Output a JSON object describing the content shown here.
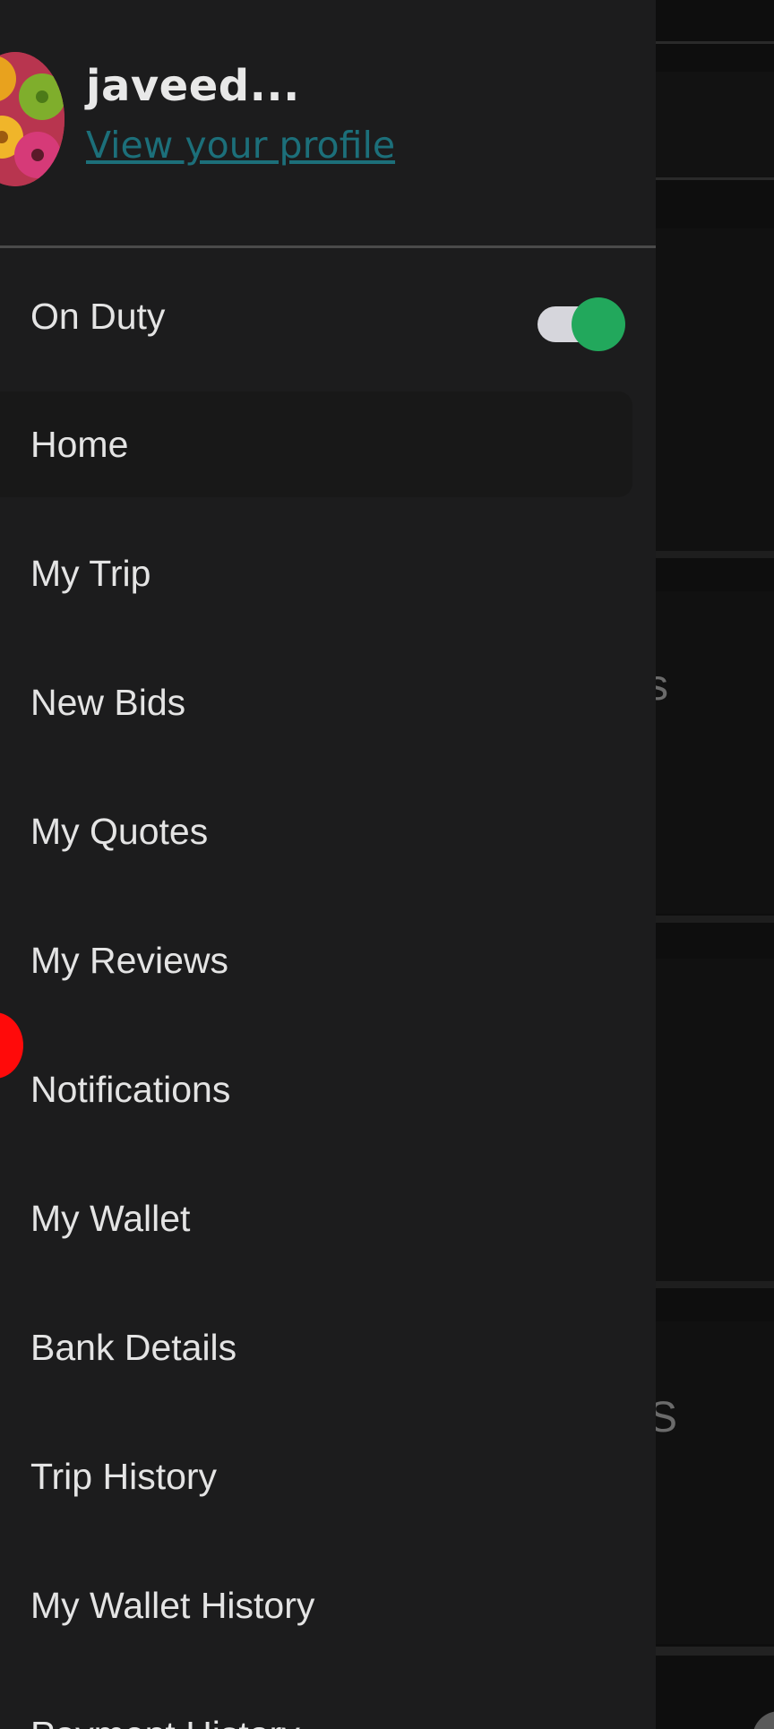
{
  "drawer": {
    "user": {
      "name": "javeed...",
      "profile_link": "View your profile",
      "avatar_icon": "flower-avatar"
    },
    "duty": {
      "label": "On Duty",
      "enabled": true
    },
    "items": [
      {
        "label": "Home",
        "active": true
      },
      {
        "label": "My Trip"
      },
      {
        "label": "New Bids"
      },
      {
        "label": "My Quotes"
      },
      {
        "label": "My Reviews"
      },
      {
        "label": "Notifications",
        "badge": "red-dot"
      },
      {
        "label": "My Wallet"
      },
      {
        "label": "Bank Details"
      },
      {
        "label": "Trip History"
      },
      {
        "label": "My Wallet History"
      },
      {
        "label": "Payment History"
      }
    ]
  },
  "background": {
    "fragment_1": "s",
    "fragment_2": "S"
  },
  "colors": {
    "drawer_bg": "#1c1c1d",
    "link": "#1c6f7a",
    "toggle_on": "#22a85c",
    "badge": "#ff0a0a"
  }
}
